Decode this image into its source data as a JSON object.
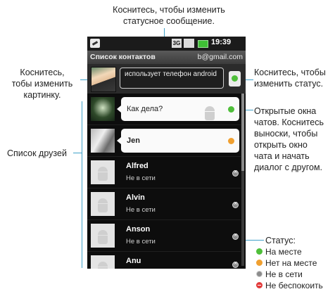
{
  "callouts": {
    "top_line1": "Коснитесь, чтобы изменить",
    "top_line2": "статусное сообщение.",
    "left_pic_1": "Коснитесь,",
    "left_pic_2": "тобы изменить",
    "left_pic_3": "картинку.",
    "left_friends": "Список друзей",
    "right_status_1": "Коснитесь, чтобы",
    "right_status_2": "изменить статус.",
    "right_chats_1": "Открытые окна",
    "right_chats_2": "чатов. Коснитесь",
    "right_chats_3": "выноски, чтобы",
    "right_chats_4": "открыть окно",
    "right_chats_5": "чата и начать",
    "right_chats_6": "диалог с другом.",
    "legend_title": "Статус:"
  },
  "legend": [
    {
      "label": "На месте",
      "color": "#4fbf3a"
    },
    {
      "label": "Нет на месте",
      "color": "#f0a030"
    },
    {
      "label": "Не в сети",
      "color": "#8c8c8c"
    },
    {
      "label": "Не беспокоить",
      "color": "#e23b3b"
    }
  ],
  "phone": {
    "status_bar": {
      "time": "19:39",
      "network": "3G"
    },
    "title": "Список контактов",
    "account": "b@gmail.com",
    "me": {
      "status_message": "использует телефон android",
      "status_color": "#4fbf3a"
    },
    "contacts": [
      {
        "name": "",
        "message": "Как дела?",
        "status": "available",
        "open_chat": true
      },
      {
        "name": "Jen",
        "message": "",
        "status": "away",
        "open_chat": true
      },
      {
        "name": "Alfred",
        "message": "Не в сети",
        "status": "offline",
        "open_chat": false
      },
      {
        "name": "Alvin",
        "message": "Не в сети",
        "status": "offline",
        "open_chat": false
      },
      {
        "name": "Anson",
        "message": "Не в сети",
        "status": "offline",
        "open_chat": false
      },
      {
        "name": "Anu",
        "message": "",
        "status": "offline",
        "open_chat": false
      }
    ]
  }
}
